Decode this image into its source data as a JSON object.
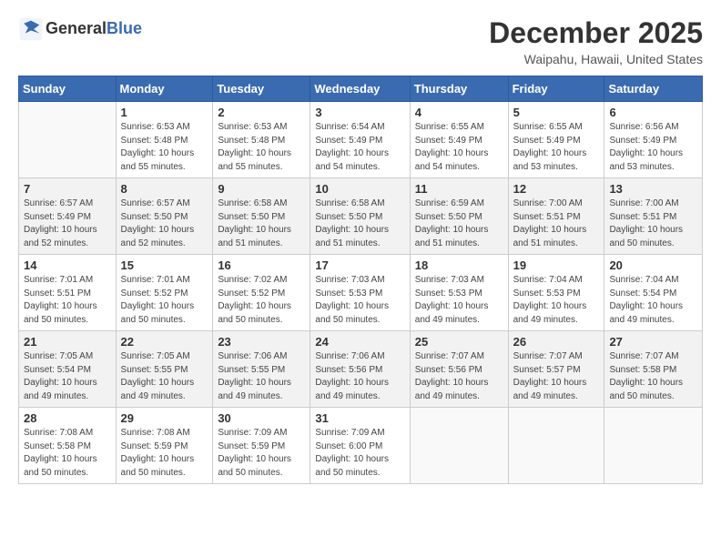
{
  "header": {
    "logo_general": "General",
    "logo_blue": "Blue",
    "month": "December 2025",
    "location": "Waipahu, Hawaii, United States"
  },
  "weekdays": [
    "Sunday",
    "Monday",
    "Tuesday",
    "Wednesday",
    "Thursday",
    "Friday",
    "Saturday"
  ],
  "weeks": [
    [
      {
        "day": "",
        "info": ""
      },
      {
        "day": "1",
        "info": "Sunrise: 6:53 AM\nSunset: 5:48 PM\nDaylight: 10 hours\nand 55 minutes."
      },
      {
        "day": "2",
        "info": "Sunrise: 6:53 AM\nSunset: 5:48 PM\nDaylight: 10 hours\nand 55 minutes."
      },
      {
        "day": "3",
        "info": "Sunrise: 6:54 AM\nSunset: 5:49 PM\nDaylight: 10 hours\nand 54 minutes."
      },
      {
        "day": "4",
        "info": "Sunrise: 6:55 AM\nSunset: 5:49 PM\nDaylight: 10 hours\nand 54 minutes."
      },
      {
        "day": "5",
        "info": "Sunrise: 6:55 AM\nSunset: 5:49 PM\nDaylight: 10 hours\nand 53 minutes."
      },
      {
        "day": "6",
        "info": "Sunrise: 6:56 AM\nSunset: 5:49 PM\nDaylight: 10 hours\nand 53 minutes."
      }
    ],
    [
      {
        "day": "7",
        "info": "Sunrise: 6:57 AM\nSunset: 5:49 PM\nDaylight: 10 hours\nand 52 minutes."
      },
      {
        "day": "8",
        "info": "Sunrise: 6:57 AM\nSunset: 5:50 PM\nDaylight: 10 hours\nand 52 minutes."
      },
      {
        "day": "9",
        "info": "Sunrise: 6:58 AM\nSunset: 5:50 PM\nDaylight: 10 hours\nand 51 minutes."
      },
      {
        "day": "10",
        "info": "Sunrise: 6:58 AM\nSunset: 5:50 PM\nDaylight: 10 hours\nand 51 minutes."
      },
      {
        "day": "11",
        "info": "Sunrise: 6:59 AM\nSunset: 5:50 PM\nDaylight: 10 hours\nand 51 minutes."
      },
      {
        "day": "12",
        "info": "Sunrise: 7:00 AM\nSunset: 5:51 PM\nDaylight: 10 hours\nand 51 minutes."
      },
      {
        "day": "13",
        "info": "Sunrise: 7:00 AM\nSunset: 5:51 PM\nDaylight: 10 hours\nand 50 minutes."
      }
    ],
    [
      {
        "day": "14",
        "info": "Sunrise: 7:01 AM\nSunset: 5:51 PM\nDaylight: 10 hours\nand 50 minutes."
      },
      {
        "day": "15",
        "info": "Sunrise: 7:01 AM\nSunset: 5:52 PM\nDaylight: 10 hours\nand 50 minutes."
      },
      {
        "day": "16",
        "info": "Sunrise: 7:02 AM\nSunset: 5:52 PM\nDaylight: 10 hours\nand 50 minutes."
      },
      {
        "day": "17",
        "info": "Sunrise: 7:03 AM\nSunset: 5:53 PM\nDaylight: 10 hours\nand 50 minutes."
      },
      {
        "day": "18",
        "info": "Sunrise: 7:03 AM\nSunset: 5:53 PM\nDaylight: 10 hours\nand 49 minutes."
      },
      {
        "day": "19",
        "info": "Sunrise: 7:04 AM\nSunset: 5:53 PM\nDaylight: 10 hours\nand 49 minutes."
      },
      {
        "day": "20",
        "info": "Sunrise: 7:04 AM\nSunset: 5:54 PM\nDaylight: 10 hours\nand 49 minutes."
      }
    ],
    [
      {
        "day": "21",
        "info": "Sunrise: 7:05 AM\nSunset: 5:54 PM\nDaylight: 10 hours\nand 49 minutes."
      },
      {
        "day": "22",
        "info": "Sunrise: 7:05 AM\nSunset: 5:55 PM\nDaylight: 10 hours\nand 49 minutes."
      },
      {
        "day": "23",
        "info": "Sunrise: 7:06 AM\nSunset: 5:55 PM\nDaylight: 10 hours\nand 49 minutes."
      },
      {
        "day": "24",
        "info": "Sunrise: 7:06 AM\nSunset: 5:56 PM\nDaylight: 10 hours\nand 49 minutes."
      },
      {
        "day": "25",
        "info": "Sunrise: 7:07 AM\nSunset: 5:56 PM\nDaylight: 10 hours\nand 49 minutes."
      },
      {
        "day": "26",
        "info": "Sunrise: 7:07 AM\nSunset: 5:57 PM\nDaylight: 10 hours\nand 49 minutes."
      },
      {
        "day": "27",
        "info": "Sunrise: 7:07 AM\nSunset: 5:58 PM\nDaylight: 10 hours\nand 50 minutes."
      }
    ],
    [
      {
        "day": "28",
        "info": "Sunrise: 7:08 AM\nSunset: 5:58 PM\nDaylight: 10 hours\nand 50 minutes."
      },
      {
        "day": "29",
        "info": "Sunrise: 7:08 AM\nSunset: 5:59 PM\nDaylight: 10 hours\nand 50 minutes."
      },
      {
        "day": "30",
        "info": "Sunrise: 7:09 AM\nSunset: 5:59 PM\nDaylight: 10 hours\nand 50 minutes."
      },
      {
        "day": "31",
        "info": "Sunrise: 7:09 AM\nSunset: 6:00 PM\nDaylight: 10 hours\nand 50 minutes."
      },
      {
        "day": "",
        "info": ""
      },
      {
        "day": "",
        "info": ""
      },
      {
        "day": "",
        "info": ""
      }
    ]
  ]
}
